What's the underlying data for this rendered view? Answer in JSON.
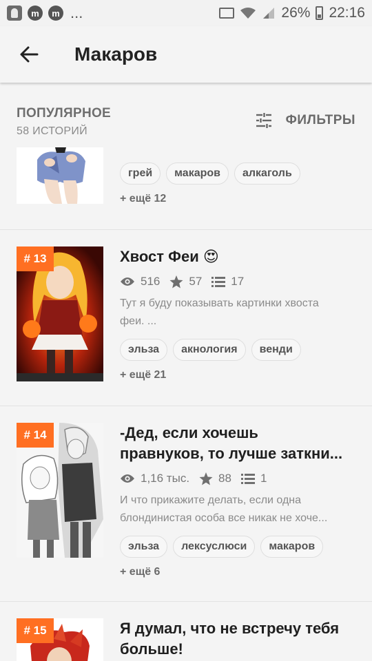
{
  "status_bar": {
    "notification_dots": "...",
    "m_icon_letter": "m",
    "battery": "26%",
    "time": "22:16"
  },
  "header": {
    "title": "Макаров",
    "back_icon": "arrow-left-icon"
  },
  "filter_bar": {
    "sort_label": "ПОПУЛЯРНОЕ",
    "story_count": "58 ИСТОРИЙ",
    "filters_label": "ФИЛЬТРЫ",
    "filters_icon": "sliders-icon"
  },
  "stories": [
    {
      "rank": "",
      "title": "",
      "tags": [
        "грей",
        "макаров",
        "алкаголь"
      ],
      "more_tags": "+ ещё 12"
    },
    {
      "rank": "# 13",
      "title": "Хвост Феи 😍",
      "views": "516",
      "votes": "57",
      "parts": "17",
      "desc": [
        "Тут я буду показывать картинки хвоста",
        "феи. ..."
      ],
      "tags": [
        "эльза",
        "акнология",
        "венди"
      ],
      "more_tags": "+ ещё 21"
    },
    {
      "rank": "# 14",
      "title": [
        "-Дед, если хочешь",
        "правнуков, то лучше заткни..."
      ],
      "views": "1,16 тыс.",
      "votes": "88",
      "parts": "1",
      "desc": [
        "И что прикажите делать, если одна",
        "блондинистая особа все никак не хоче..."
      ],
      "tags": [
        "эльза",
        "лексуслюси",
        "макаров"
      ],
      "more_tags": "+ ещё 6"
    },
    {
      "rank": "# 15",
      "title": [
        "Я думал, что не встречу тебя",
        "больше!"
      ]
    }
  ],
  "colors": {
    "rank_badge": "#ff6f22",
    "background": "#f4f4f4",
    "text_primary": "#1f1f1f",
    "text_muted": "#8a8a8a"
  }
}
